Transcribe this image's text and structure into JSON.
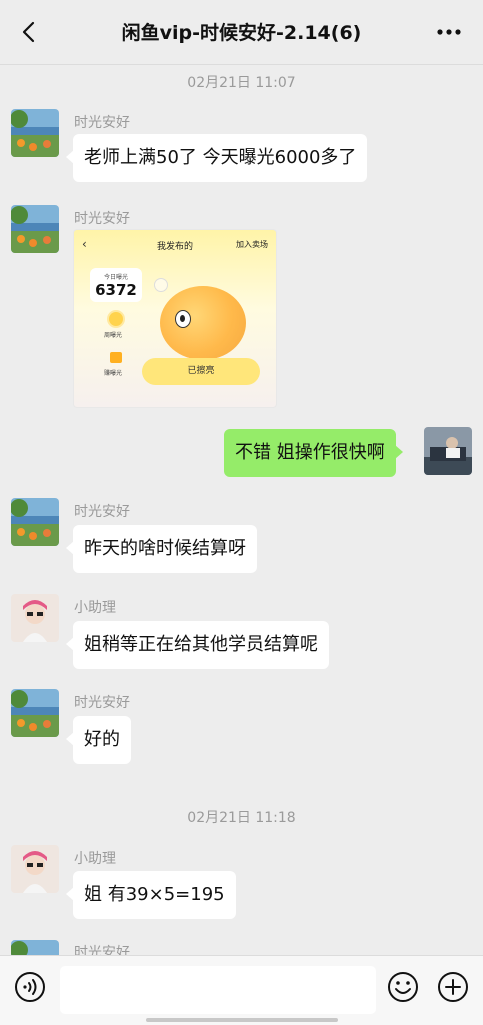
{
  "header": {
    "title": "闲鱼vip-时候安好-2.14(6)"
  },
  "timestamps": [
    "02月21日 11:07",
    "02月21日 11:18"
  ],
  "senders": {
    "shiguang": "时光安好",
    "assistant": "小助理"
  },
  "messages": {
    "m1": "老师上满50了 今天曝光6000多了",
    "m3": "不错 姐操作很快啊",
    "m4": "昨天的啥时候结算呀",
    "m5": "姐稍等正在给其他学员结算呢",
    "m6": "好的",
    "m7": "姐 有39×5=195"
  },
  "shared_image": {
    "back": "‹",
    "title": "我发布的",
    "join": "加入卖场",
    "card_label": "今日曝光",
    "card_value": "6372",
    "coin_label": "周曝光",
    "gift_label": "赚曝光",
    "button": "已擦亮"
  },
  "colors": {
    "background": "#ededed",
    "self_bubble": "#95ec69",
    "other_bubble": "#ffffff"
  },
  "icons": [
    "back-icon",
    "more-icon",
    "voice-icon",
    "emoji-icon",
    "plus-icon"
  ]
}
